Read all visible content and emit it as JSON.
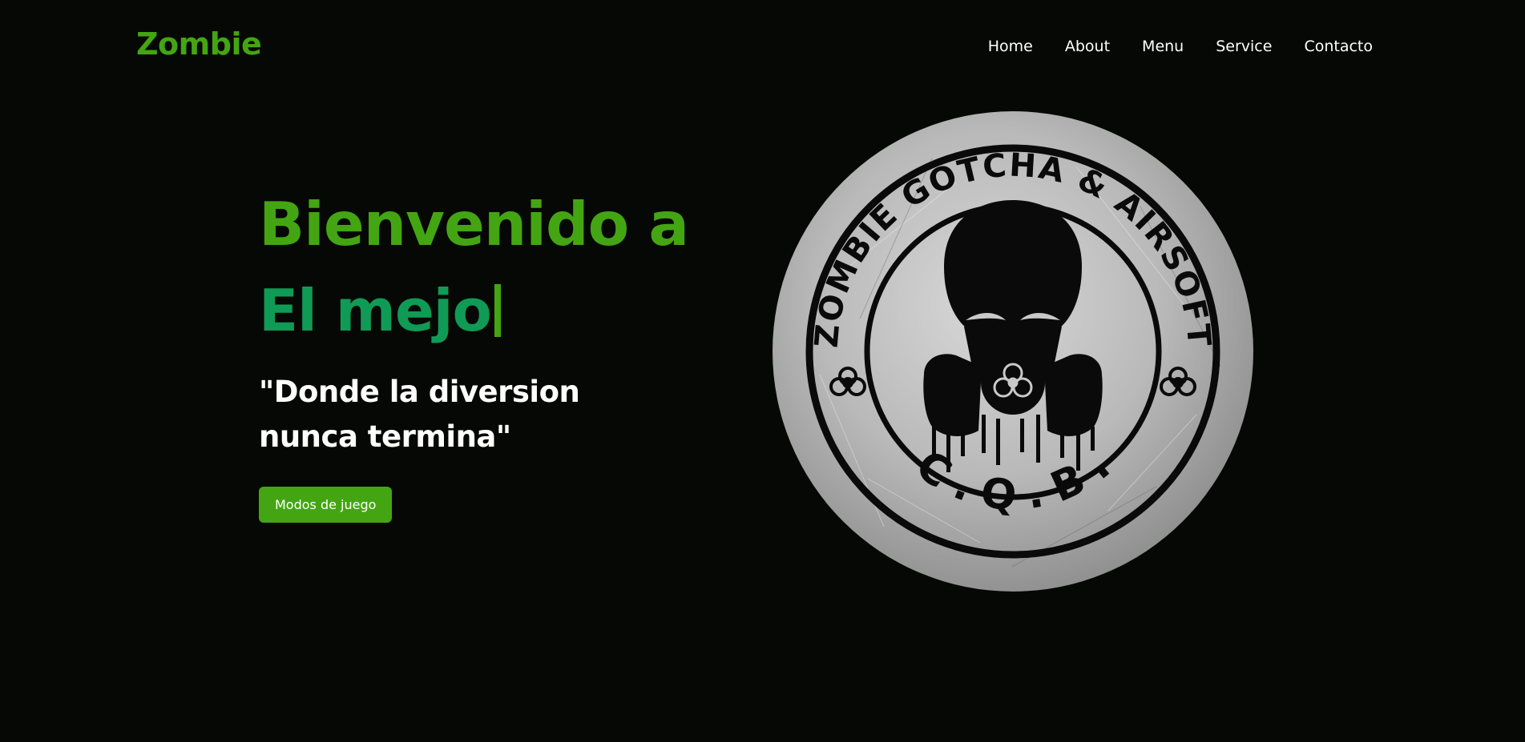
{
  "brand": {
    "name": "Zombie"
  },
  "nav": {
    "items": [
      {
        "label": "Home"
      },
      {
        "label": "About"
      },
      {
        "label": "Menu"
      },
      {
        "label": "Service"
      },
      {
        "label": "Contacto"
      }
    ]
  },
  "hero": {
    "title": "Bienvenido a",
    "typed_text": "El mejo",
    "quote": "\"Donde la diversion nunca termina\"",
    "cta_label": "Modos de juego"
  },
  "logo": {
    "top_text": "ZOMBIE GOTCHA & AIRSOFT",
    "bottom_text": "C . Q . B ."
  },
  "colors": {
    "background": "#060805",
    "accent": "#44a513",
    "typed": "#0f9b55",
    "text": "#ffffff"
  }
}
